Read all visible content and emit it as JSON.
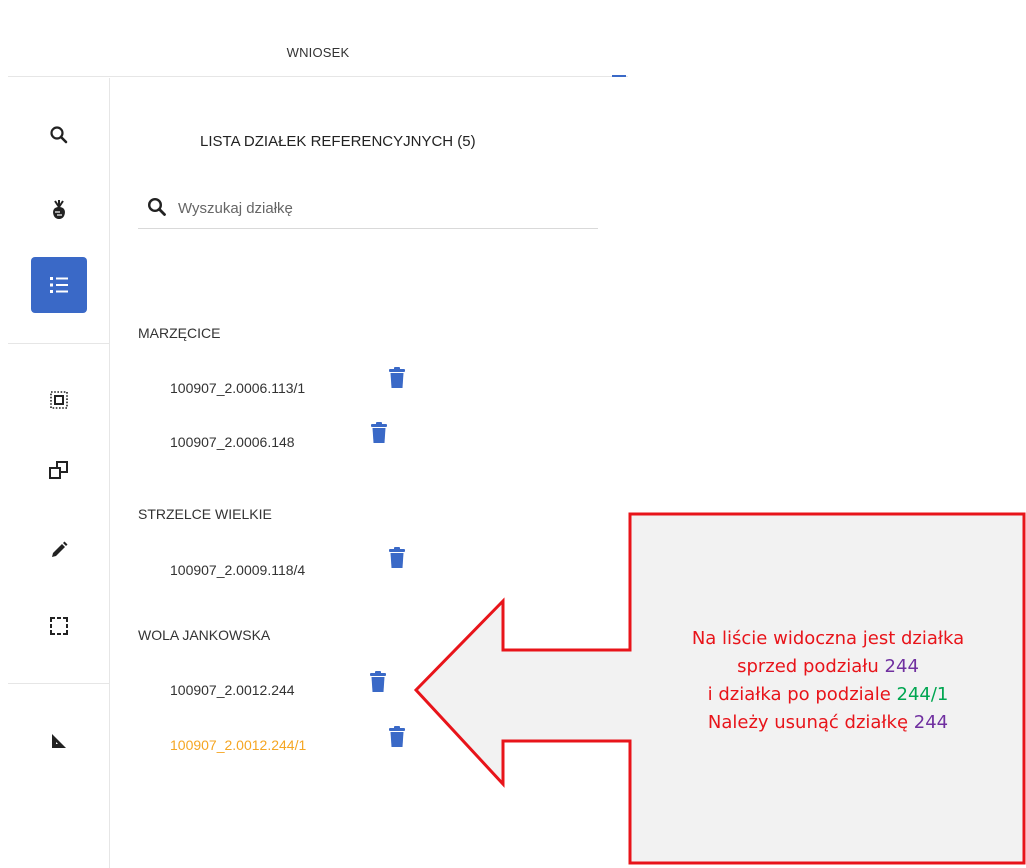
{
  "tab": {
    "label": "WNIOSEK"
  },
  "rail": {
    "icons": [
      "search-icon",
      "crop-icon",
      "list-icon",
      "select-area-icon",
      "copy-icon",
      "pencil-icon",
      "selection-frame-icon",
      "ruler-icon"
    ],
    "active": "list-icon",
    "active_color": "#3a69c7"
  },
  "panel": {
    "title": "LISTA DZIAŁEK REFERENCYJNYCH (5)",
    "search_placeholder": "Wyszukaj działkę",
    "groups": [
      {
        "name": "MARZĘCICE",
        "parcels": [
          "100907_2.0006.113/1",
          "100907_2.0006.148"
        ]
      },
      {
        "name": "STRZELCE WIELKIE",
        "parcels": [
          "100907_2.0009.118/4"
        ]
      },
      {
        "name": "WOLA JANKOWSKA",
        "parcels": [
          "100907_2.0012.244",
          "100907_2.0012.244/1"
        ]
      }
    ],
    "highlight_color": "#f5a623",
    "trash_color": "#3a69c7"
  },
  "callout": {
    "line1": "Na liście widoczna jest działka",
    "line2_prefix": "sprzed podziału ",
    "line2_num": "244",
    "line3_prefix": "i działka po podziale ",
    "line3_num": "244/1",
    "line4_prefix": "Należy usunąć działkę ",
    "line4_num": "244",
    "text_color": "#e8141a",
    "border_color": "#e8141a",
    "fill_color": "#f2f2f2"
  }
}
